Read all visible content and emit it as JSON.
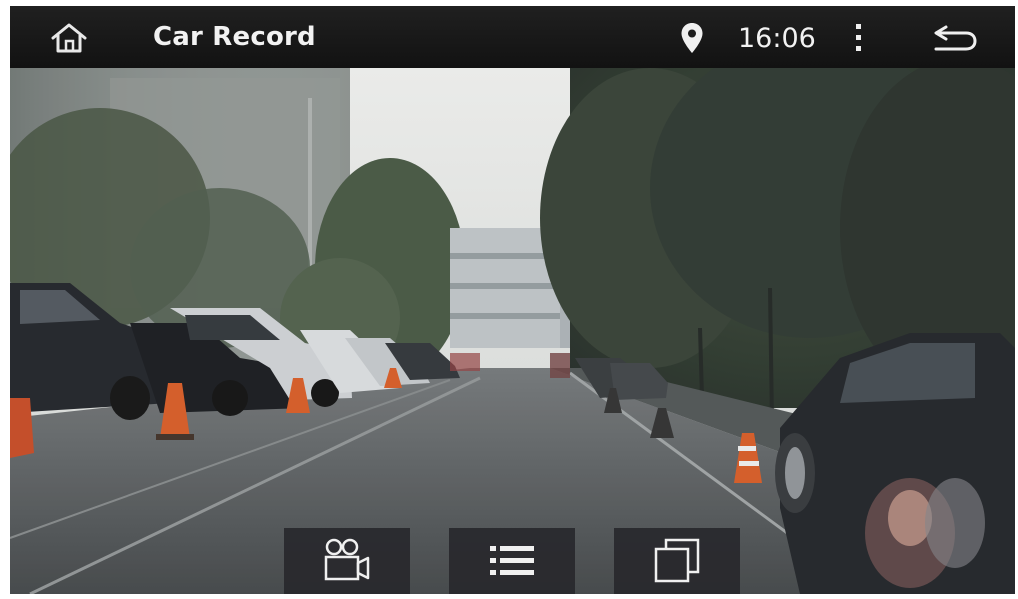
{
  "app": {
    "title": "Car Record",
    "time": "16:06"
  },
  "icons": {
    "home": "home-icon",
    "location": "location-pin-icon",
    "menu": "more-vertical-icon",
    "back": "back-arrow-icon",
    "record": "video-camera-icon",
    "list": "list-icon",
    "window": "multi-window-icon"
  },
  "colors": {
    "topbar": "#181818",
    "text": "#f2f2f2",
    "button_bg": "#2a2a2e"
  }
}
